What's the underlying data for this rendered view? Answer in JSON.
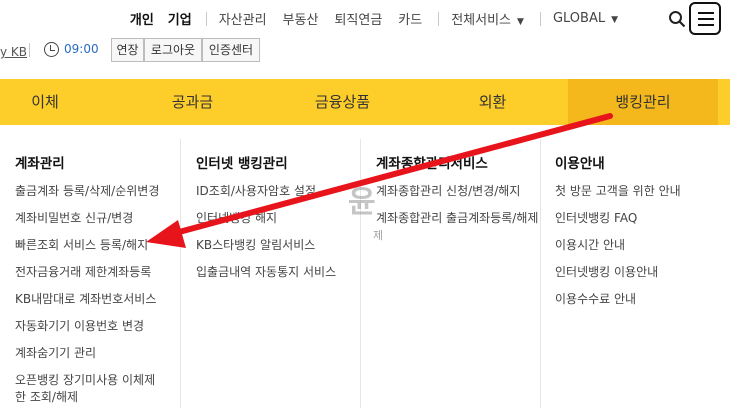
{
  "topnav": {
    "personal": "개인",
    "business": "기업",
    "items": [
      "자산관리",
      "부동산",
      "퇴직연금",
      "카드"
    ],
    "all_services": "전체서비스",
    "global": "GLOBAL"
  },
  "session": {
    "kb_link": "y KB",
    "time": "09:00",
    "extend": "연장",
    "logout": "로그아웃",
    "cert_center": "인증센터"
  },
  "menu": {
    "items": [
      "이체",
      "공과금",
      "금융상품",
      "외환",
      "뱅킹관리"
    ],
    "active_index": 4
  },
  "mega": {
    "col1": {
      "title": "계좌관리",
      "items": [
        "출금계좌 등록/삭제/순위변경",
        "계좌비밀번호 신규/변경",
        "빠른조회 서비스 등록/해지",
        "전자금융거래 제한계좌등록",
        "KB내맘대로 계좌번호서비스",
        "자동화기기 이용번호 변경",
        "계좌숨기기 관리",
        "오픈뱅킹 장기미사용 이체제한 조회/해제"
      ]
    },
    "col2": {
      "title": "인터넷 뱅킹관리",
      "items": [
        "ID조회/사용자암호 설정",
        "인터넷뱅킹 해지",
        "KB스타뱅킹 알림서비스",
        "입출금내역 자동통지 서비스"
      ]
    },
    "col3": {
      "title": "계좌종합관리서비스",
      "items": [
        "계좌종합관리 신청/변경/해지",
        "계좌종합관리 출금계좌등록/해제"
      ]
    },
    "col4": {
      "title": "이용안내",
      "items": [
        "첫 방문 고객을 위한 안내",
        "인터넷뱅킹 FAQ",
        "이용시간 안내",
        "인터넷뱅킹 이용안내",
        "이용수수료 안내"
      ]
    }
  },
  "watermark": {
    "text": "윤",
    "sub": "제"
  },
  "colors": {
    "menu_bg": "#fdcd29",
    "menu_active": "#f4b81c",
    "arrow": "#e8141c",
    "time": "#2a6cc0"
  }
}
